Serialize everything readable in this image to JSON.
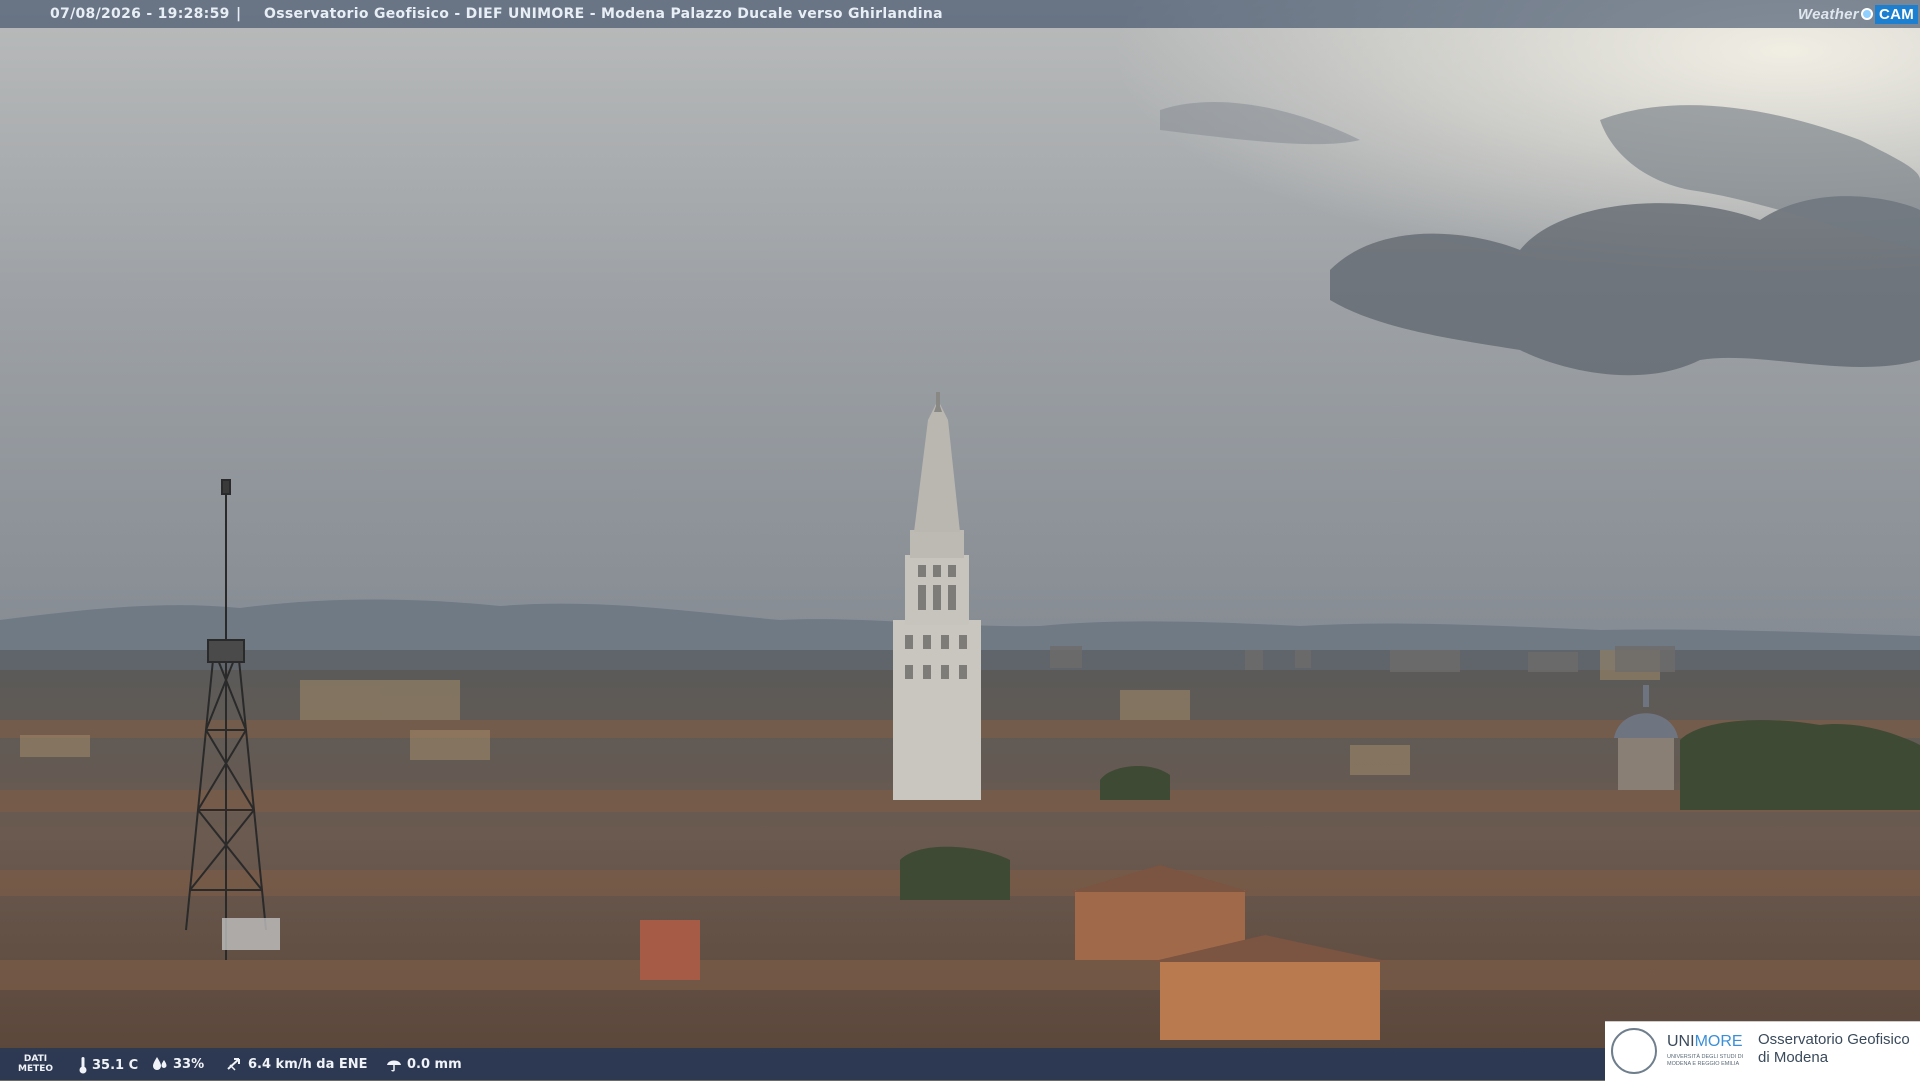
{
  "overlay": {
    "datetime": "07/08/2026 - 19:28:59",
    "separator": "|",
    "title": "Osservatorio Geofisico - DIEF UNIMORE - Modena Palazzo Ducale verso Ghirlandina",
    "brand_weather": "Weather",
    "brand_cam": "CAM"
  },
  "meteo": {
    "label_line1": "DATI",
    "label_line2": "METEO",
    "temperature": "35.1 C",
    "humidity": "33%",
    "wind": "6.4 km/h da ENE",
    "rain": "0.0 mm"
  },
  "logo": {
    "uni": "UNI",
    "more": "MORE",
    "uni_sub": "UNIVERSITÀ DEGLI STUDI DI MODENA E REGGIO EMILIA",
    "observatory_line1": "Osservatorio Geofisico",
    "observatory_line2": "di Modena"
  },
  "colors": {
    "sky": "#8c9196",
    "roofs": "#7a5a48",
    "tower": "#c9c6c0",
    "bar": "#1c345c",
    "accent": "#3b8fd8"
  }
}
